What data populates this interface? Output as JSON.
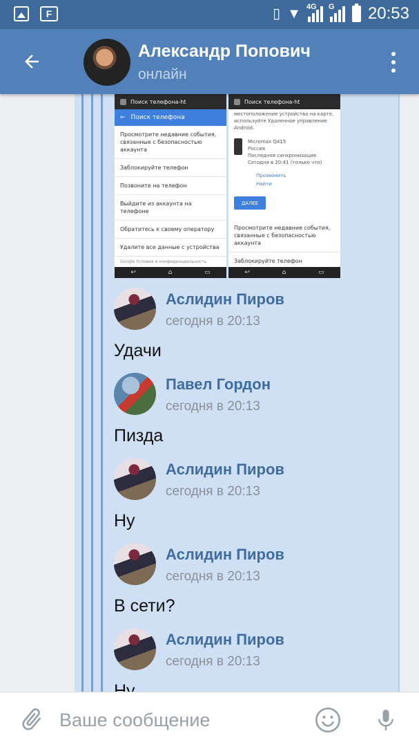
{
  "status_bar": {
    "time": "20:53",
    "network_label": "4G",
    "network_label_2": "G",
    "icons": [
      "image-icon",
      "flipboard-icon",
      "vibrate-icon",
      "wifi-icon",
      "signal-icon",
      "signal-icon",
      "battery-icon"
    ]
  },
  "header": {
    "contact_name": "Александр Попович",
    "status": "онлайн"
  },
  "forwarded_screenshots": {
    "left": {
      "bar_title": "Поиск телефона-ht",
      "title": "Поиск телефона",
      "rows": [
        "Просмотрите недавние события, связанные с безопасностью аккаунта",
        "Заблокируйте телефон",
        "Позвоните на телефон",
        "Выйдите из аккаунта на телефоне",
        "Обратитесь к своему оператору",
        "Удалите все данные с устройства"
      ],
      "footer": "Google     Условия и конфиденциальность"
    },
    "right": {
      "bar_title": "Поиск телефона-ht",
      "intro": "местоположение устройства на карте, используйте Удаленное управление Android.",
      "device_name": "Micromax Q415",
      "device_country": "Россия",
      "device_sync": "Последняя синхронизация: Сегодня в 20:41 (только что)",
      "call_link": "Прозвонить",
      "find_link": "Найти",
      "next_button": "ДАЛЕЕ",
      "row_1": "Просмотрите недавние события, связанные с безопасностью аккаунта",
      "row_2": "Заблокируйте телефон"
    }
  },
  "messages": [
    {
      "author": "Аслидин Пиров",
      "time": "сегодня в 20:13",
      "text": "Удачи",
      "avatar": "avatar-asl"
    },
    {
      "author": "Павел Гордон",
      "time": "сегодня в 20:13",
      "text": "Пизда",
      "avatar": "avatar-pavel"
    },
    {
      "author": "Аслидин Пиров",
      "time": "сегодня в 20:13",
      "text": "Ну",
      "avatar": "avatar-asl"
    },
    {
      "author": "Аслидин Пиров",
      "time": "сегодня в 20:13",
      "text": "В сети?",
      "avatar": "avatar-asl"
    },
    {
      "author": "Аслидин Пиров",
      "time": "сегодня в 20:13",
      "text": "Ну",
      "avatar": "avatar-asl"
    }
  ],
  "composer": {
    "placeholder": "Ваше сообщение"
  },
  "colors": {
    "status_bar": "#3e6a9b",
    "header": "#5181b8",
    "author_name": "#3f6c9e",
    "forward_panel": "#cfe0f4"
  }
}
